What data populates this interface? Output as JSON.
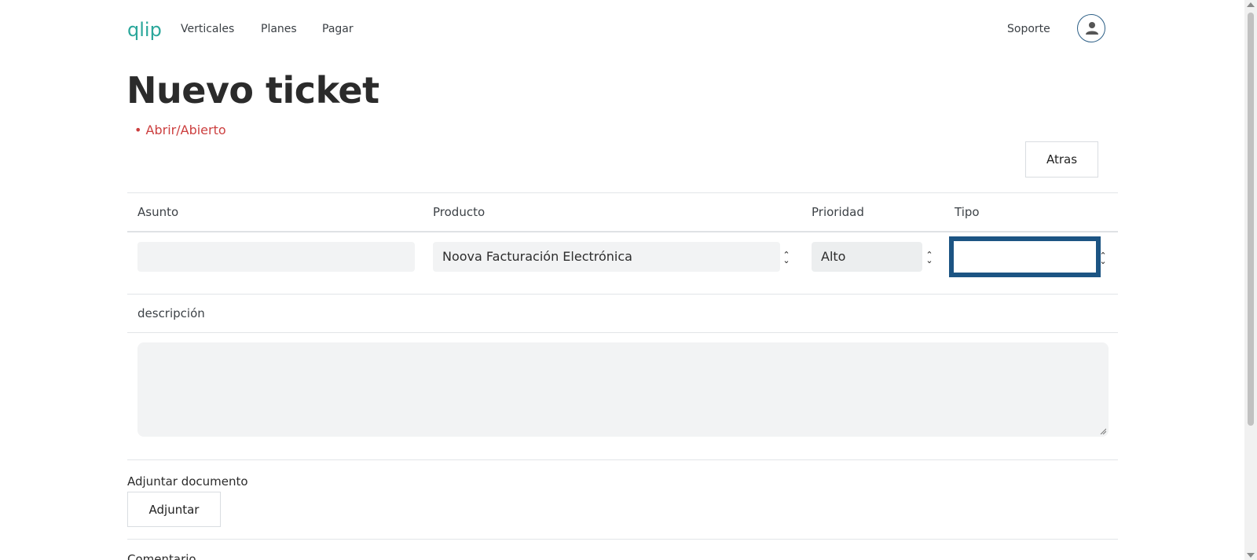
{
  "header": {
    "logo": "qlip",
    "nav": [
      "Verticales",
      "Planes",
      "Pagar"
    ],
    "support": "Soporte",
    "avatar_icon": "user-icon"
  },
  "page": {
    "title": "Nuevo ticket",
    "status": "• Abrir/Abierto",
    "back_button": "Atras"
  },
  "form": {
    "columns": [
      "Asunto",
      "Producto",
      "Prioridad",
      "Tipo"
    ],
    "asunto_value": "",
    "producto_value": "Noova Facturación Electrónica",
    "prioridad_value": "Alto",
    "tipo_value": "",
    "description_label": "descripción",
    "description_value": "",
    "attach_label": "Adjuntar documento",
    "attach_button": "Adjuntar",
    "comment_label": "Comentario"
  },
  "colors": {
    "accent": "#2aa79b",
    "status": "#cc3f3f",
    "focus": "#1c5483"
  }
}
